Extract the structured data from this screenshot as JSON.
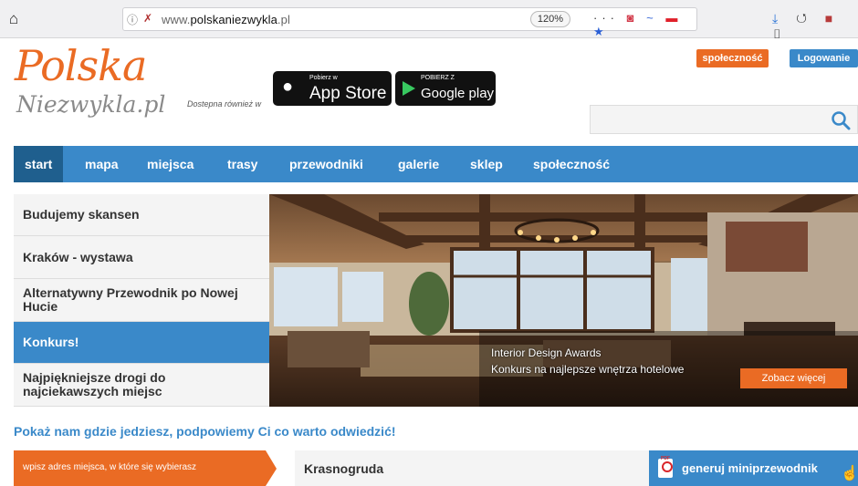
{
  "browser": {
    "home_icon": "home-icon",
    "url_domain_prefix": "www.",
    "url_domain_main": "polskaniezwykla",
    "url_domain_suffix": ".pl",
    "zoom": "120%",
    "more_icon": "•••"
  },
  "header": {
    "logo_main": "Polska",
    "logo_sub": "Niezwykla.pl",
    "available_text": "Dostepna również w",
    "appstore_small": "Pobierz w",
    "appstore_big": "App Store",
    "googleplay_small": "POBIERZ Z",
    "googleplay_big": "Google play",
    "community_button": "społeczność",
    "login_button": "Logowanie"
  },
  "nav": {
    "items": [
      "start",
      "mapa",
      "miejsca",
      "trasy",
      "przewodniki",
      "galerie",
      "sklep",
      "społeczność"
    ],
    "active": "start"
  },
  "sidebar": {
    "items": [
      "Budujemy skansen",
      "Kraków - wystawa",
      "Alternatywny Przewodnik po Nowej Hucie",
      "Konkurs!",
      "Najpiękniejsze drogi do najciekawszych miejsc"
    ],
    "active_index": 3
  },
  "hero": {
    "caption_title": "Interior Design Awards",
    "caption_text": "Konkurs na najlepsze wnętrza hotelowe",
    "more_button": "Zobacz więcej"
  },
  "tagline": "Pokaż nam gdzie jedziesz, podpowiemy Ci co warto odwiedzić!",
  "planner": {
    "placeholder": "wpisz adres miejsca, w które się wybierasz",
    "place_name": "Krasnogruda",
    "generate_button": "generuj miniprzewodnik"
  }
}
